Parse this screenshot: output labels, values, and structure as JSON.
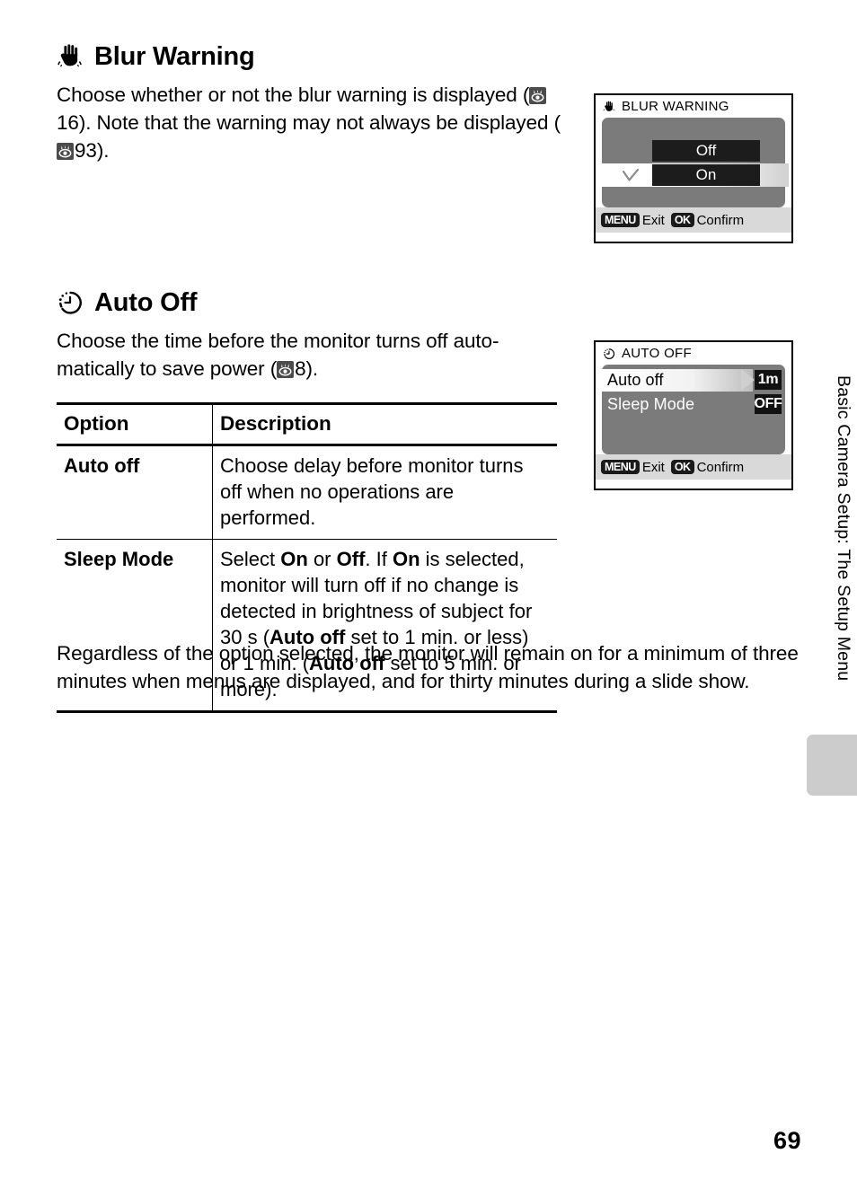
{
  "page": {
    "number": "69",
    "side_label": "Basic Camera Setup: The Setup Menu"
  },
  "sections": [
    {
      "icon": "shaking-hand-icon",
      "title": "Blur Warning",
      "body_parts": {
        "p1": "Choose whether or not the blur warning is displayed (",
        "ref1": "16). Note that the warning may not always be displayed (",
        "ref2": "93)."
      }
    },
    {
      "icon": "clock-icon",
      "title": "Auto Off",
      "body_parts": {
        "p1": "Choose the time before the monitor turns off auto-matically to save power (",
        "ref1": "8)."
      }
    }
  ],
  "blur_body": {
    "lead": "Choose whether or not the blur warning is displayed (",
    "page_ref_1": "16",
    "mid": "). Note that the warning may not always be displayed (",
    "page_ref_2": "93",
    "tail": ")."
  },
  "autooff_body": {
    "lead": "Choose the time before the monitor turns off auto-matically to save power (",
    "page_ref_1": "8",
    "tail": ")."
  },
  "table": {
    "headers": {
      "option": "Option",
      "description": "Description"
    },
    "rows": [
      {
        "option": "Auto off",
        "description": "Choose delay before monitor turns off when no operations are performed."
      },
      {
        "option": "Sleep Mode",
        "description_segments": [
          {
            "text": "Select ",
            "bold": false
          },
          {
            "text": "On",
            "bold": true
          },
          {
            "text": " or ",
            "bold": false
          },
          {
            "text": "Off",
            "bold": true
          },
          {
            "text": ". If ",
            "bold": false
          },
          {
            "text": "On",
            "bold": true
          },
          {
            "text": " is selected, monitor will turn off if no change is detected in brightness of subject for 30 s (",
            "bold": false
          },
          {
            "text": "Auto off",
            "bold": true
          },
          {
            "text": " set to 1 min. or less) or 1 min. (",
            "bold": false
          },
          {
            "text": "Auto off",
            "bold": true
          },
          {
            "text": " set to 5 min. or more).",
            "bold": false
          }
        ]
      }
    ]
  },
  "footnote": "Regardless of the option selected, the monitor will remain on for a minimum of three minutes when menus are displayed, and for thirty minutes during a slide show.",
  "monitors": {
    "blur_warning": {
      "title": "BLUR WARNING",
      "title_icon": "shaking-hand-icon",
      "options": [
        "Off",
        "On"
      ],
      "selected": "On",
      "checked": "On",
      "footer": [
        {
          "key": "MENU",
          "label": "Exit"
        },
        {
          "key": "OK",
          "label": "Confirm"
        }
      ]
    },
    "auto_off": {
      "title": "AUTO OFF",
      "title_icon": "clock-icon",
      "rows": [
        {
          "label": "Auto off",
          "value": "1m",
          "selected": true
        },
        {
          "label": "Sleep Mode",
          "value": "OFF",
          "selected": false
        }
      ],
      "footer": [
        {
          "key": "MENU",
          "label": "Exit"
        },
        {
          "key": "OK",
          "label": "Confirm"
        }
      ]
    }
  },
  "colors": {
    "monitor_body": "#7b7b7b",
    "monitor_footer": "#d9d9d9",
    "option_box": "#1c1c1c",
    "side_tab": "#cccccc"
  }
}
